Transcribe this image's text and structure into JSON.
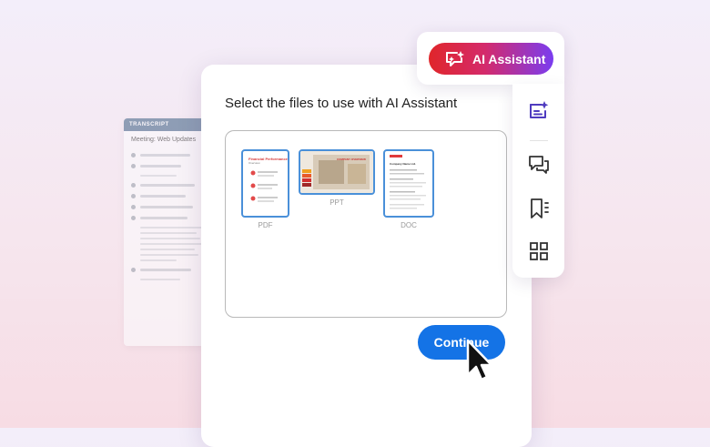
{
  "transcript": {
    "header": "TRANSCRIPT",
    "title": "Meeting: Web Updates"
  },
  "dialog": {
    "title": "Select the files to use with AI Assistant",
    "files": [
      {
        "type_label": "PDF",
        "thumb_title": "Financial Performance",
        "thumb_sub": "Overview"
      },
      {
        "type_label": "PPT",
        "thumb_title": "COMPANY OVERVIEW"
      },
      {
        "type_label": "DOC",
        "thumb_title": "Company Name Ltd."
      }
    ],
    "continue_label": "Continue"
  },
  "ai_assistant": {
    "label": "AI Assistant"
  },
  "toolbar": {
    "tools": [
      "ai-chat-icon",
      "comment-icon",
      "bookmark-icon",
      "grid-icon"
    ]
  },
  "colors": {
    "accent_blue": "#1473e6",
    "thumb_border": "#4a90d9",
    "ai_gradient_start": "#e0262a",
    "ai_gradient_end": "#7a3df0",
    "tool_icon_active": "#4f3bbf"
  }
}
